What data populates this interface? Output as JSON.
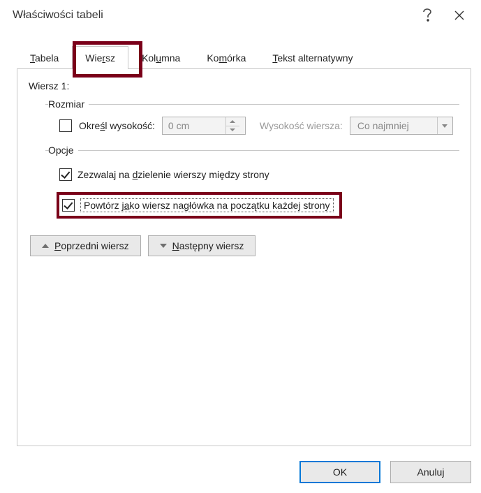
{
  "window": {
    "title": "Właściwości tabeli"
  },
  "tabs": {
    "items": [
      {
        "label_pre": "",
        "label_u": "T",
        "label_post": "abela"
      },
      {
        "label_pre": "Wie",
        "label_u": "r",
        "label_post": "sz"
      },
      {
        "label_pre": "Kol",
        "label_u": "u",
        "label_post": "mna"
      },
      {
        "label_pre": "Ko",
        "label_u": "m",
        "label_post": "órka"
      },
      {
        "label_pre": "",
        "label_u": "T",
        "label_post": "ekst alternatywny"
      }
    ],
    "active_index": 1
  },
  "row_panel": {
    "current_row_label": "Wiersz 1:",
    "size_group": {
      "legend": "Rozmiar",
      "specify_height": {
        "checked": false,
        "label_pre": "Okre",
        "label_u": "ś",
        "label_post": "l wysokość:"
      },
      "height_value": "0 cm",
      "height_type_label": "Wysokość wiersza:",
      "height_type_value": "Co najmniej"
    },
    "options_group": {
      "legend": "Opcje",
      "allow_break": {
        "checked": true,
        "label_pre": "Zezwalaj na ",
        "label_u": "d",
        "label_post": "zielenie wierszy między strony"
      },
      "repeat_header": {
        "checked": true,
        "label_pre": "Powtórz j",
        "label_u": "a",
        "label_post": "ko wiersz nagłówka na początku każdej strony"
      }
    },
    "nav": {
      "prev_pre": "",
      "prev_u": "P",
      "prev_post": "oprzedni wiersz",
      "next_pre": "",
      "next_u": "N",
      "next_post": "astępny wiersz"
    }
  },
  "footer": {
    "ok": "OK",
    "cancel": "Anuluj"
  }
}
